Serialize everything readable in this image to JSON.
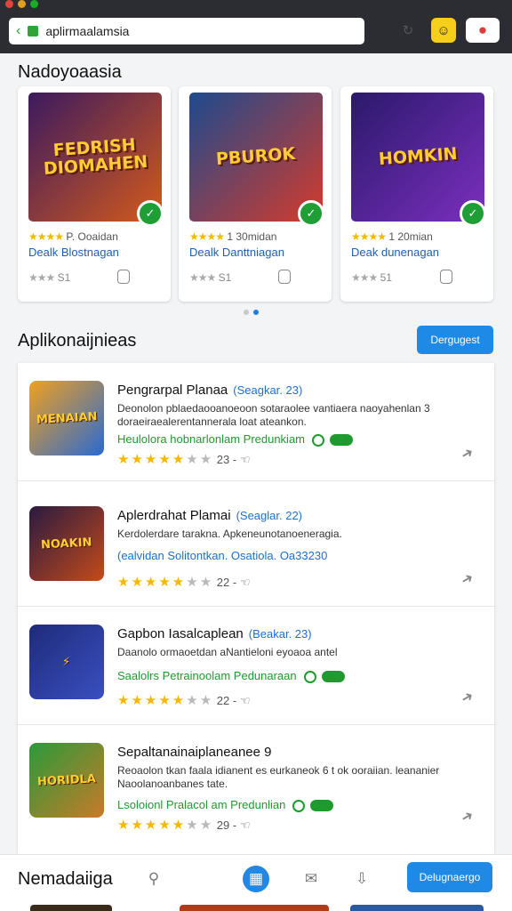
{
  "browser": {
    "url": "aplirmaalamsia",
    "colors": {
      "dot_red": "#e0443e",
      "dot_yellow": "#dea123",
      "dot_green": "#1aab29"
    }
  },
  "featured": {
    "title": "Nadoyoaasia",
    "cards": [
      {
        "art_text": "FEDRISH DIOMAHEN",
        "rating_value": "P. Ooaidan",
        "developer": "Dealk Blostnagan",
        "footer_value": "S1",
        "colors": [
          "#3b1a5e",
          "#d35a1c"
        ]
      },
      {
        "art_text": "PBUROK",
        "rating_value": "1 30midan",
        "developer": "Dealk Danttniagan",
        "footer_value": "S1",
        "colors": [
          "#1d4a8e",
          "#d43b2b"
        ]
      },
      {
        "art_text": "HOMKIN",
        "rating_value": "1 20mian",
        "developer": "Deak dunenagan",
        "footer_value": "51",
        "colors": [
          "#2a1a6b",
          "#7b2fbe"
        ]
      }
    ]
  },
  "applications": {
    "title": "Aplikonaijnieas",
    "see_all_label": "Dergugest",
    "items": [
      {
        "title": "Pengrarpal Planaa",
        "version": "(Seagkar. 23)",
        "description": "Deonolon pblaedaooanoeoon sotaraolee vantiaera naoyahenlan 3 doraeiraealerentannerala loat ateankon.",
        "green_text": "Heulolora hobnarlonlam Predunkiam",
        "green_extras": true,
        "rating_text": "23 -",
        "icon_text": "MENAIAN",
        "icon_colors": [
          "#f0a020",
          "#2a6ad0"
        ],
        "stars_on": 5
      },
      {
        "title": "Aplerdrahat Plamai",
        "version": "(Seaglar. 22)",
        "description": "Kerdolerdare tarakna. Apkeneunotanoeneragia.",
        "green_text": "(ealvidan Solitontkan. Osatiola. Oa33230",
        "green_extras": false,
        "rating_text": "22 -",
        "icon_text": "NOAKIN",
        "icon_colors": [
          "#2a1a40",
          "#c44a1a"
        ],
        "stars_on": 5
      },
      {
        "title": "Gapbon Iasalcaplean",
        "version": "(Beakar. 23)",
        "description": "Daanolo ormaoetdan aNantieloni eyoaoa antel",
        "green_text": "Saalolrs Petrainoolam Pedunaraan",
        "green_extras": true,
        "rating_text": "22 -",
        "icon_text": "",
        "icon_colors": [
          "#1e2b7a",
          "#3a4fc0"
        ],
        "stars_on": 5
      },
      {
        "title": "Sepaltanainaiplaneanee 9",
        "version": "",
        "description": "Reoaolon tkan faala idianent es eurkaneok 6 t ok ooraiian. leananier Naoolanoanbanes tate.",
        "green_text": "Lsoloionl Pralacol am Predunlian",
        "green_extras": true,
        "rating_text": "29 -",
        "icon_text": "HORIDLA",
        "icon_colors": [
          "#2a9a3a",
          "#c87a2a"
        ],
        "stars_on": 5
      }
    ]
  },
  "bottom_bar": {
    "title": "Nemadaiiga",
    "button_label": "Delugnaergo",
    "icons": [
      "search-icon",
      "store-icon",
      "chat-icon",
      "download-icon"
    ]
  }
}
